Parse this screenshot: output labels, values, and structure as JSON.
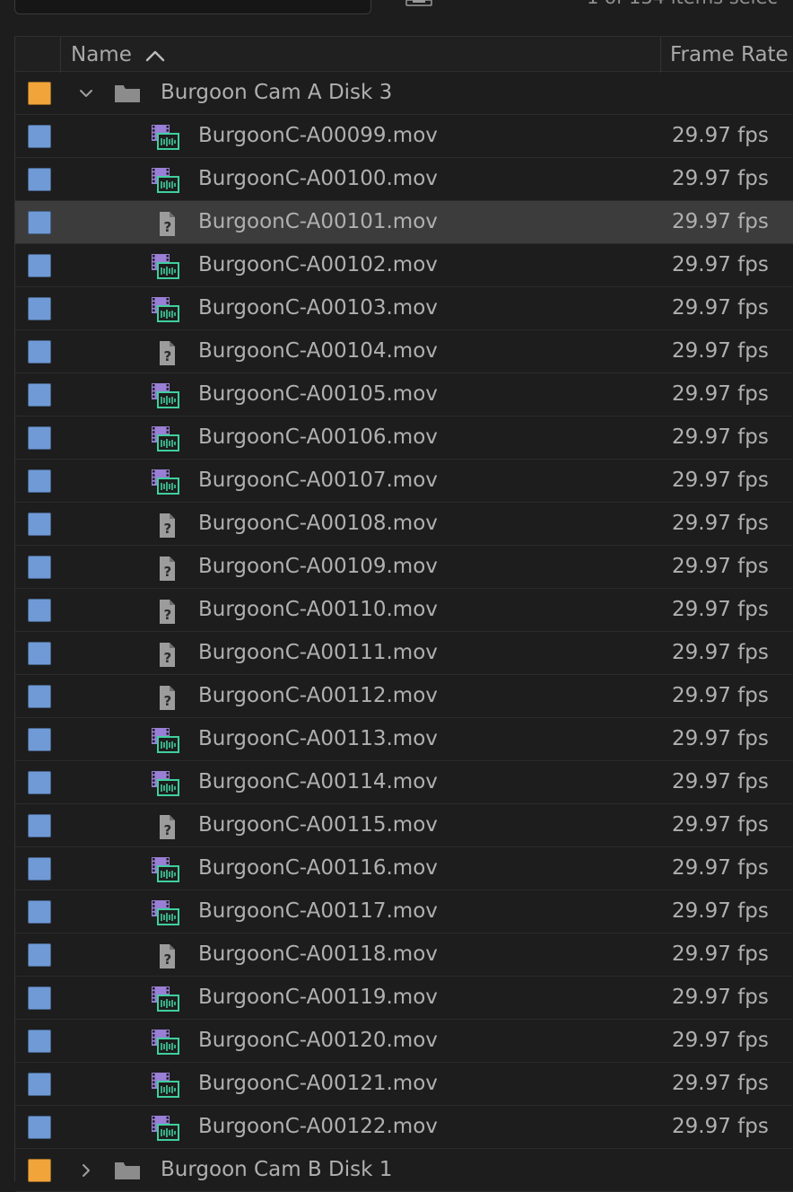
{
  "top": {
    "status_text": "1 of 134 items selec"
  },
  "header": {
    "name_label": "Name",
    "frame_rate_label": "Frame Rate",
    "sort": "ascending"
  },
  "colors": {
    "bin_label": "#f0a43a",
    "clip_label": "#6f9ad6",
    "selected_row": "#3c3c3c",
    "video_icon_purple": "#9a7fd6",
    "video_icon_green": "#3fcf9e"
  },
  "folders": [
    {
      "name": "Burgoon Cam A Disk 3",
      "expanded": true
    },
    {
      "name": "Burgoon Cam B Disk 1",
      "expanded": false
    }
  ],
  "files": [
    {
      "name": "BurgoonC-A00099.mov",
      "frame_rate": "29.97 fps",
      "icon": "video-clip-icon",
      "selected": false
    },
    {
      "name": "BurgoonC-A00100.mov",
      "frame_rate": "29.97 fps",
      "icon": "video-clip-icon",
      "selected": false
    },
    {
      "name": "BurgoonC-A00101.mov",
      "frame_rate": "29.97 fps",
      "icon": "offline-file-icon",
      "selected": true
    },
    {
      "name": "BurgoonC-A00102.mov",
      "frame_rate": "29.97 fps",
      "icon": "video-clip-icon",
      "selected": false
    },
    {
      "name": "BurgoonC-A00103.mov",
      "frame_rate": "29.97 fps",
      "icon": "video-clip-icon",
      "selected": false
    },
    {
      "name": "BurgoonC-A00104.mov",
      "frame_rate": "29.97 fps",
      "icon": "offline-file-icon",
      "selected": false
    },
    {
      "name": "BurgoonC-A00105.mov",
      "frame_rate": "29.97 fps",
      "icon": "video-clip-icon",
      "selected": false
    },
    {
      "name": "BurgoonC-A00106.mov",
      "frame_rate": "29.97 fps",
      "icon": "video-clip-icon",
      "selected": false
    },
    {
      "name": "BurgoonC-A00107.mov",
      "frame_rate": "29.97 fps",
      "icon": "video-clip-icon",
      "selected": false
    },
    {
      "name": "BurgoonC-A00108.mov",
      "frame_rate": "29.97 fps",
      "icon": "offline-file-icon",
      "selected": false
    },
    {
      "name": "BurgoonC-A00109.mov",
      "frame_rate": "29.97 fps",
      "icon": "offline-file-icon",
      "selected": false
    },
    {
      "name": "BurgoonC-A00110.mov",
      "frame_rate": "29.97 fps",
      "icon": "offline-file-icon",
      "selected": false
    },
    {
      "name": "BurgoonC-A00111.mov",
      "frame_rate": "29.97 fps",
      "icon": "offline-file-icon",
      "selected": false
    },
    {
      "name": "BurgoonC-A00112.mov",
      "frame_rate": "29.97 fps",
      "icon": "offline-file-icon",
      "selected": false
    },
    {
      "name": "BurgoonC-A00113.mov",
      "frame_rate": "29.97 fps",
      "icon": "video-clip-icon",
      "selected": false
    },
    {
      "name": "BurgoonC-A00114.mov",
      "frame_rate": "29.97 fps",
      "icon": "video-clip-icon",
      "selected": false
    },
    {
      "name": "BurgoonC-A00115.mov",
      "frame_rate": "29.97 fps",
      "icon": "offline-file-icon",
      "selected": false
    },
    {
      "name": "BurgoonC-A00116.mov",
      "frame_rate": "29.97 fps",
      "icon": "video-clip-icon",
      "selected": false
    },
    {
      "name": "BurgoonC-A00117.mov",
      "frame_rate": "29.97 fps",
      "icon": "video-clip-icon",
      "selected": false
    },
    {
      "name": "BurgoonC-A00118.mov",
      "frame_rate": "29.97 fps",
      "icon": "offline-file-icon",
      "selected": false
    },
    {
      "name": "BurgoonC-A00119.mov",
      "frame_rate": "29.97 fps",
      "icon": "video-clip-icon",
      "selected": false
    },
    {
      "name": "BurgoonC-A00120.mov",
      "frame_rate": "29.97 fps",
      "icon": "video-clip-icon",
      "selected": false
    },
    {
      "name": "BurgoonC-A00121.mov",
      "frame_rate": "29.97 fps",
      "icon": "video-clip-icon",
      "selected": false
    },
    {
      "name": "BurgoonC-A00122.mov",
      "frame_rate": "29.97 fps",
      "icon": "video-clip-icon",
      "selected": false
    }
  ]
}
